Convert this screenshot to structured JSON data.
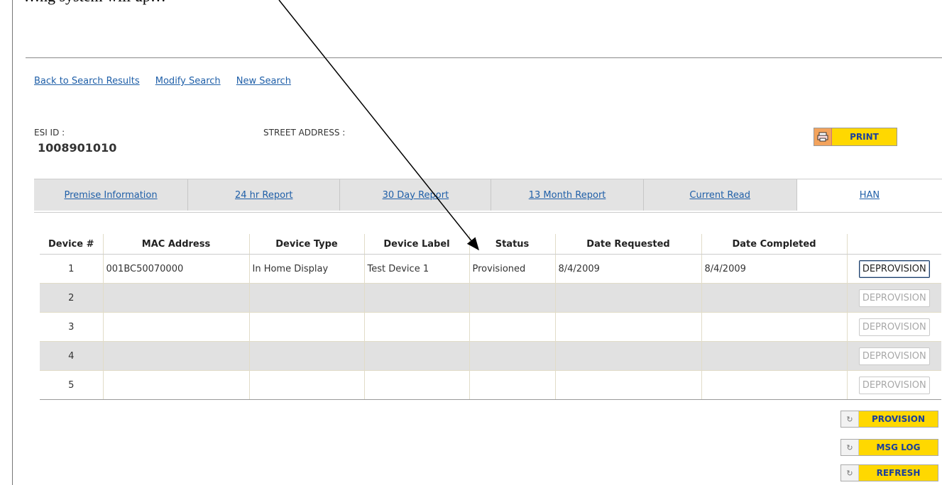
{
  "doc_fragment": "…ng system will up…",
  "nav_links": [
    "Back to Search Results",
    "Modify Search",
    "New Search"
  ],
  "esi": {
    "label": "ESI ID :",
    "value": "1008901010"
  },
  "address": {
    "label": "STREET ADDRESS :"
  },
  "print_button": {
    "label": "PRINT",
    "icon": "printer-icon"
  },
  "tabs": [
    {
      "label": "Premise Information",
      "active": false
    },
    {
      "label": "24 hr Report",
      "active": false
    },
    {
      "label": "30 Day Report",
      "active": false
    },
    {
      "label": "13 Month Report",
      "active": false
    },
    {
      "label": "Current Read",
      "active": false
    },
    {
      "label": "HAN",
      "active": true
    }
  ],
  "devices": {
    "headers": [
      "Device #",
      "MAC Address",
      "Device Type",
      "Device Label",
      "Status",
      "Date Requested",
      "Date Completed",
      ""
    ],
    "rows": [
      {
        "num": "1",
        "mac": "001BC50070000",
        "type": "In Home Display",
        "label": "Test Device 1",
        "status": "Provisioned",
        "requested": "8/4/2009",
        "completed": "8/4/2009",
        "button": "DEPROVISION",
        "enabled": true
      },
      {
        "num": "2",
        "mac": "",
        "type": "",
        "label": "",
        "status": "",
        "requested": "",
        "completed": "",
        "button": "DEPROVISION",
        "enabled": false
      },
      {
        "num": "3",
        "mac": "",
        "type": "",
        "label": "",
        "status": "",
        "requested": "",
        "completed": "",
        "button": "DEPROVISION",
        "enabled": false
      },
      {
        "num": "4",
        "mac": "",
        "type": "",
        "label": "",
        "status": "",
        "requested": "",
        "completed": "",
        "button": "DEPROVISION",
        "enabled": false
      },
      {
        "num": "5",
        "mac": "",
        "type": "",
        "label": "",
        "status": "",
        "requested": "",
        "completed": "",
        "button": "DEPROVISION",
        "enabled": false
      }
    ]
  },
  "actions": [
    {
      "label": "PROVISION",
      "icon": "refresh-icon"
    },
    {
      "label": "MSG LOG",
      "icon": "refresh-icon"
    },
    {
      "label": "REFRESH",
      "icon": "refresh-icon"
    }
  ],
  "colors": {
    "accent_yellow": "#ffd800",
    "link_blue": "#1f5fa8",
    "row_alt": "#e1e1e1"
  }
}
